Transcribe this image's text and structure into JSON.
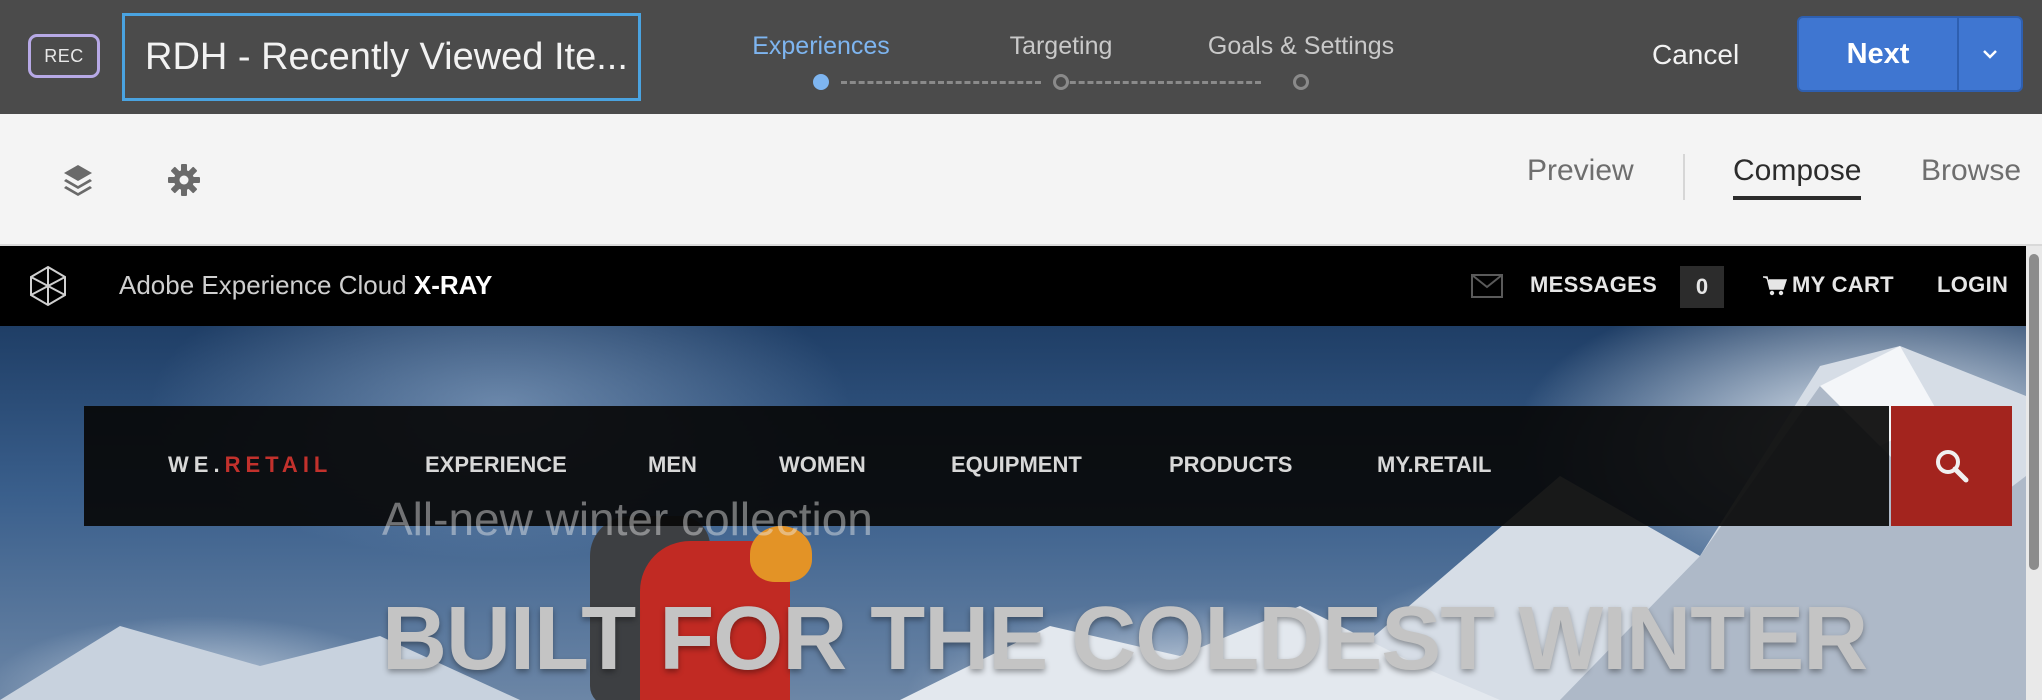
{
  "topbar": {
    "badge": "REC",
    "activity_name": "RDH - Recently Viewed Ite...",
    "steps": [
      {
        "label": "Experiences",
        "active": true
      },
      {
        "label": "Targeting",
        "active": false
      },
      {
        "label": "Goals & Settings",
        "active": false
      }
    ],
    "cancel_label": "Cancel",
    "next_label": "Next"
  },
  "toolbar": {
    "icons": [
      "layers-icon",
      "gear-icon"
    ],
    "modes": [
      {
        "label": "Preview",
        "active": false
      },
      {
        "label": "Compose",
        "active": true
      },
      {
        "label": "Browse",
        "active": false
      }
    ]
  },
  "site": {
    "header": {
      "brand_prefix": "Adobe Experience Cloud ",
      "brand_bold": "X-RAY",
      "messages_label": "MESSAGES",
      "messages_count": "0",
      "cart_label": "MY CART",
      "login_label": "LOGIN"
    },
    "nav": {
      "logo_prefix": "WE.",
      "logo_suffix": "RETAIL",
      "items": [
        "EXPERIENCE",
        "MEN",
        "WOMEN",
        "EQUIPMENT",
        "PRODUCTS",
        "MY.RETAIL"
      ]
    },
    "hero": {
      "subtitle": "All-new winter collection",
      "title": "BUILT FOR THE COLDEST WINTER"
    }
  },
  "colors": {
    "topbar_bg": "#4b4b4b",
    "accent_blue": "#3f76d1",
    "active_step": "#7eb5f0",
    "brand_red": "#c2312c"
  }
}
